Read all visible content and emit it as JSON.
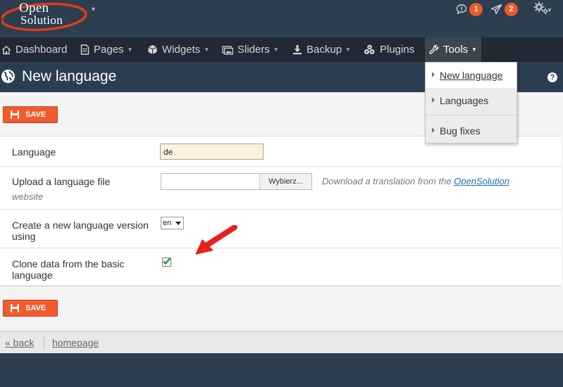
{
  "brand": {
    "line1": "Open",
    "line2": "Solution",
    "accent": "#e23b1a"
  },
  "top_icons": [
    {
      "icon": "comment-icon",
      "count": "1"
    },
    {
      "icon": "paper-plane-icon",
      "count": "2"
    },
    {
      "icon": "gears-icon"
    }
  ],
  "nav": {
    "dashboard": "Dashboard",
    "pages": "Pages",
    "widgets": "Widgets",
    "sliders": "Sliders",
    "backup": "Backup",
    "plugins": "Plugins",
    "tools": "Tools"
  },
  "page": {
    "title": "New language",
    "help": "?"
  },
  "buttons": {
    "save": "SAVE"
  },
  "form": {
    "language_label": "Language",
    "language_value": "de",
    "upload_label": "Upload a language file",
    "upload_sub": "website",
    "file_button": "Wybierz...",
    "hint_text": "Download a translation from the ",
    "hint_link": "OpenSolution",
    "version_label": "Create a new language version using",
    "version_selected": "en",
    "clone_label": "Clone data from the basic language",
    "clone_checked": true
  },
  "footer": {
    "back": "« back",
    "homepage": "homepage"
  },
  "dropdown": {
    "items": [
      "New language",
      "Languages",
      "Bug fixes"
    ]
  }
}
